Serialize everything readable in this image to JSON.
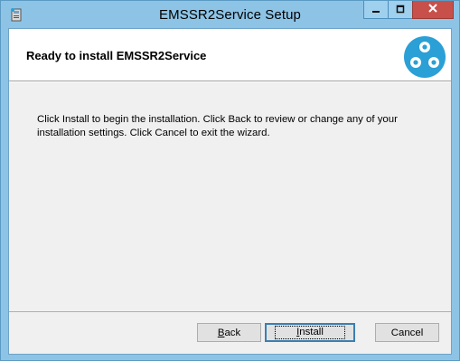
{
  "window": {
    "title": "EMSSR2Service Setup",
    "icon": "installer-icon",
    "caption_buttons": {
      "minimize_icon": "minimize-icon",
      "maximize_icon": "maximize-icon",
      "close_icon": "close-icon"
    }
  },
  "banner": {
    "title": "Ready to install EMSSR2Service",
    "logo_icon": "app-logo-icon"
  },
  "body": {
    "message": "Click Install to begin the installation. Click Back to review or change any of your installation settings. Click Cancel to exit the wizard."
  },
  "buttons": {
    "back": {
      "accel": "B",
      "rest": "ack"
    },
    "install": {
      "accel": "I",
      "rest": "nstall"
    },
    "cancel": "Cancel"
  },
  "colors": {
    "frame": "#8dc4e6",
    "close_button": "#c7504b",
    "dialog_bg": "#f0f0f0",
    "logo": "#2aa0d6"
  }
}
